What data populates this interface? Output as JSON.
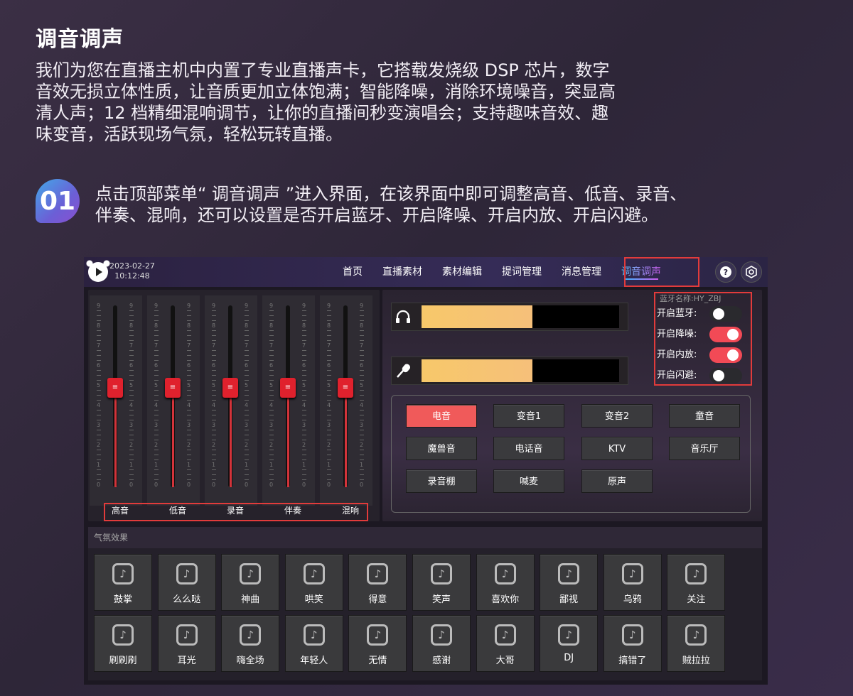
{
  "page": {
    "title": "调音调声",
    "intro_lines": [
      "我们为您在直播主机中内置了专业直播声卡，它搭载发烧级 DSP 芯片，数字",
      "音效无损立体性质，让音质更加立体饱满；智能降噪，消除环境噪音，突显高",
      "清人声；12 档精细混响调节，让你的直播间秒变演唱会；支持趣味音效、趣",
      "味变音，活跃现场气氛，轻松玩转直播。"
    ],
    "step_number": "01",
    "step_lines": [
      "点击顶部菜单“ 调音调声 ”进入界面，在该界面中即可调整高音、低音、录音、",
      "伴奏、混响，还可以设置是否开启蓝牙、开启降噪、开启内放、开启闪避。"
    ]
  },
  "app": {
    "date": "2023-02-27",
    "time": "10:12:48",
    "nav": [
      "首页",
      "直播素材",
      "素材编辑",
      "提词管理",
      "消息管理",
      "调音调声"
    ],
    "active_nav": "调音调声",
    "icons": {
      "help": "help-icon",
      "settings": "settings-icon"
    },
    "mixer": {
      "scale": [
        "9",
        "8",
        "7",
        "6",
        "5",
        "4",
        "3",
        "2",
        "1",
        "0"
      ],
      "channels": [
        {
          "label": "高音",
          "level": 5
        },
        {
          "label": "低音",
          "level": 5
        },
        {
          "label": "录音",
          "level": 5
        },
        {
          "label": "伴奏",
          "level": 5
        },
        {
          "label": "混响",
          "level": 5
        }
      ]
    },
    "meters": [
      {
        "icon": "headphones-icon",
        "fill": 0.56
      },
      {
        "icon": "microphone-icon",
        "fill": 0.56
      }
    ],
    "bluetooth_name": "蓝牙名称:HY_ZBJ",
    "toggles": [
      {
        "label": "开启蓝牙:",
        "on": false
      },
      {
        "label": "开启降噪:",
        "on": true
      },
      {
        "label": "开启内放:",
        "on": true
      },
      {
        "label": "开启闪避:",
        "on": false
      }
    ],
    "voices": [
      "电音",
      "变音1",
      "变音2",
      "童音",
      "魔兽音",
      "电话音",
      "KTV",
      "音乐厅",
      "录音棚",
      "喊麦",
      "原声"
    ],
    "active_voice": "电音",
    "atmosphere": {
      "title": "气氛效果",
      "effects": [
        "鼓掌",
        "么么哒",
        "神曲",
        "哄笑",
        "得意",
        "笑声",
        "喜欢你",
        "鄙视",
        "乌鸦",
        "关注",
        "刷刷刷",
        "耳光",
        "嗨全场",
        "年轻人",
        "无情",
        "感谢",
        "大哥",
        "DJ",
        "搞错了",
        "贼拉拉"
      ]
    },
    "colors": {
      "accent": "#f05a5a",
      "highlight_box": "#e23b3b",
      "meter": "#f7c86a"
    }
  }
}
